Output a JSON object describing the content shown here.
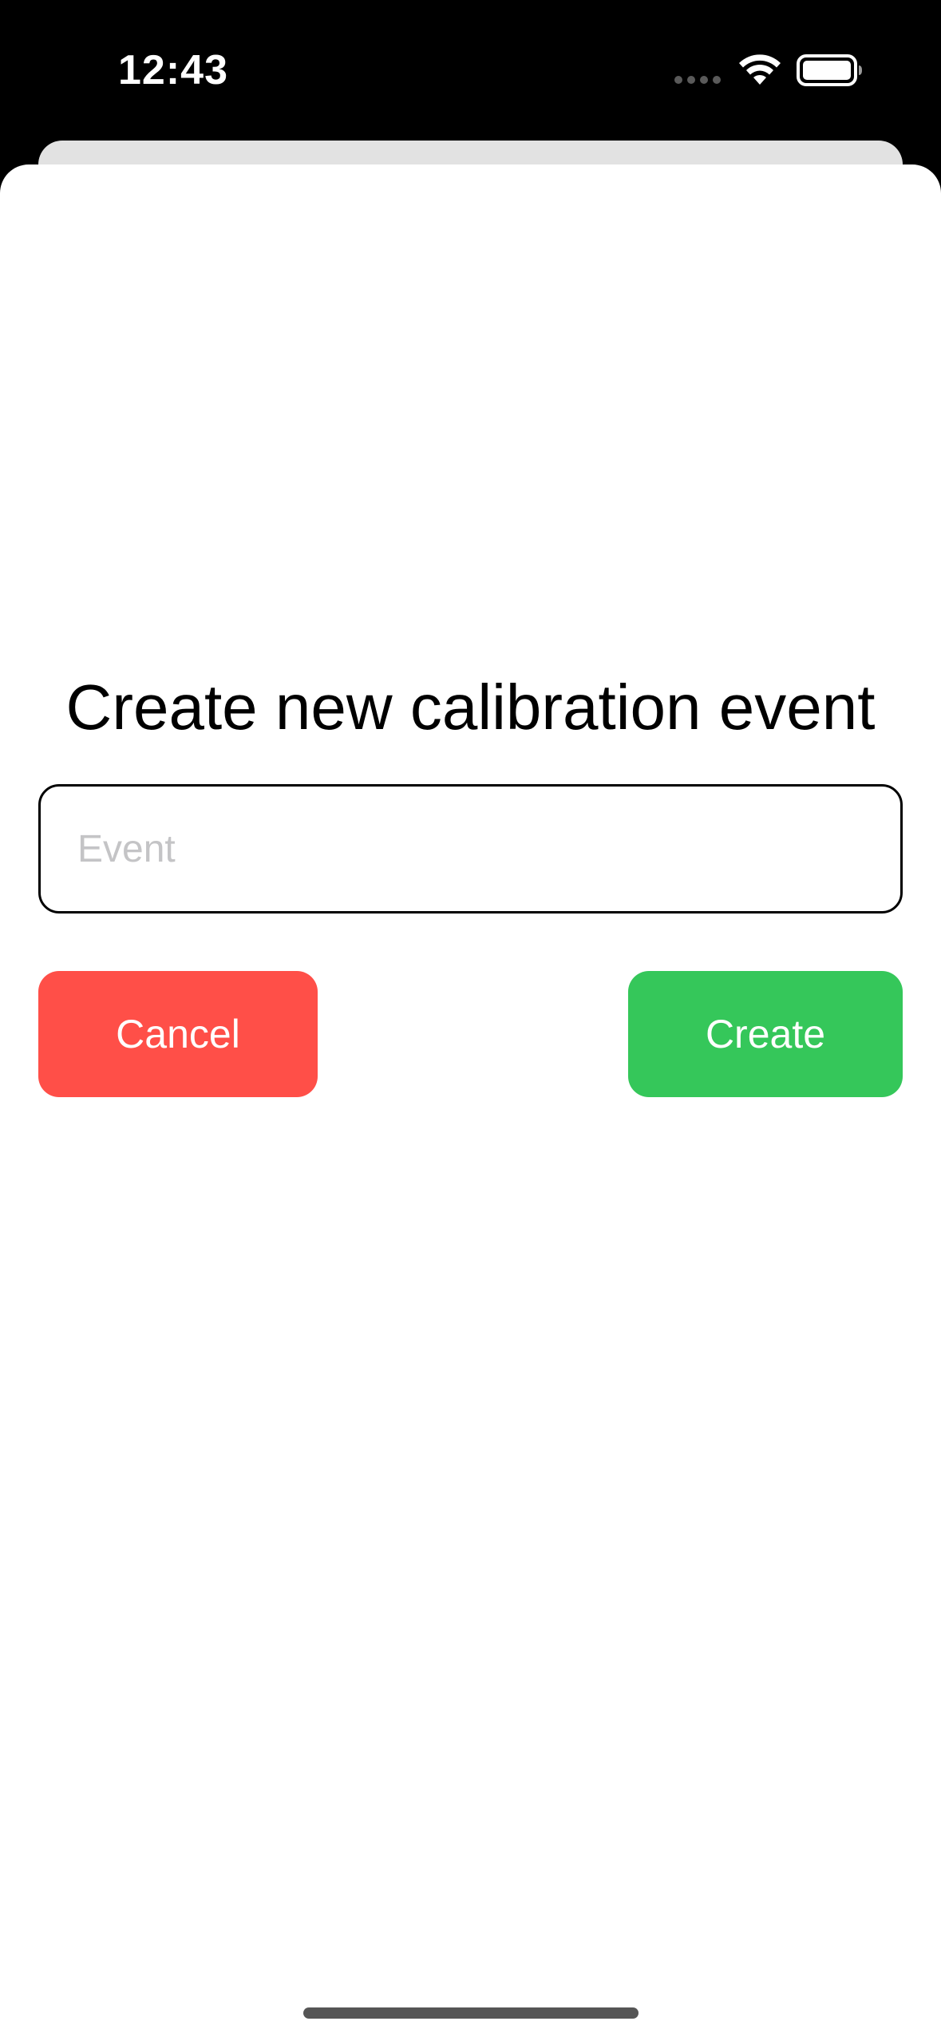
{
  "status_bar": {
    "time": "12:43",
    "icons": [
      "signal-dots-icon",
      "wifi-icon",
      "battery-icon"
    ]
  },
  "dialog": {
    "title": "Create new calibration event",
    "event_input": {
      "value": "",
      "placeholder": "Event"
    },
    "cancel_label": "Cancel",
    "create_label": "Create"
  },
  "colors": {
    "cancel": "#ff4f48",
    "create": "#35c75a",
    "background_card": "#e2e2e2"
  }
}
